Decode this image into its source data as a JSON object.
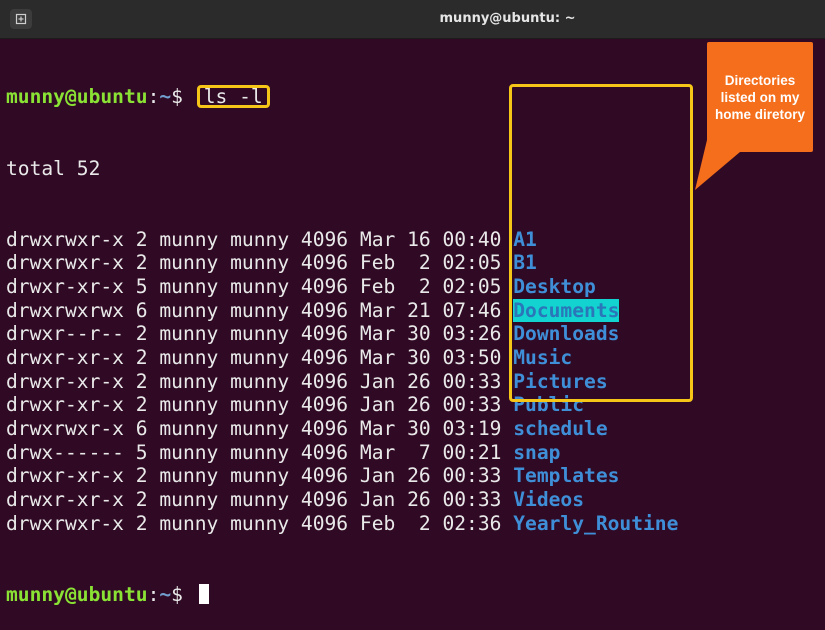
{
  "window": {
    "title": "munny@ubuntu: ~"
  },
  "prompt": {
    "user_host": "munny@ubuntu",
    "sep": ":",
    "path": "~",
    "symbol": "$ "
  },
  "command": "ls -l",
  "total": "total 52",
  "rows": [
    {
      "meta": "drwxrwxr-x 2 munny munny 4096 Mar 16 00:40 ",
      "name": "A1"
    },
    {
      "meta": "drwxrwxr-x 2 munny munny 4096 Feb  2 02:05 ",
      "name": "B1"
    },
    {
      "meta": "drwxr-xr-x 5 munny munny 4096 Feb  2 02:05 ",
      "name": "Desktop"
    },
    {
      "meta": "drwxrwxrwx 6 munny munny 4096 Mar 21 07:46 ",
      "name": "Documents"
    },
    {
      "meta": "drwxr--r-- 2 munny munny 4096 Mar 30 03:26 ",
      "name": "Downloads"
    },
    {
      "meta": "drwxr-xr-x 2 munny munny 4096 Mar 30 03:50 ",
      "name": "Music"
    },
    {
      "meta": "drwxr-xr-x 2 munny munny 4096 Jan 26 00:33 ",
      "name": "Pictures"
    },
    {
      "meta": "drwxr-xr-x 2 munny munny 4096 Jan 26 00:33 ",
      "name": "Public"
    },
    {
      "meta": "drwxrwxr-x 6 munny munny 4096 Mar 30 03:19 ",
      "name": "schedule"
    },
    {
      "meta": "drwx------ 5 munny munny 4096 Mar  7 00:21 ",
      "name": "snap"
    },
    {
      "meta": "drwxr-xr-x 2 munny munny 4096 Jan 26 00:33 ",
      "name": "Templates"
    },
    {
      "meta": "drwxr-xr-x 2 munny munny 4096 Jan 26 00:33 ",
      "name": "Videos"
    },
    {
      "meta": "drwxrwxr-x 2 munny munny 4096 Feb  2 02:36 ",
      "name": "Yearly_Routine"
    }
  ],
  "callout": "Directories listed on my home diretory",
  "colors": {
    "terminal_bg": "#300a24",
    "prompt_user": "#8ae234",
    "prompt_path": "#729fcf",
    "directory": "#3f8fd8",
    "highlight_box": "#f5c518",
    "callout_bg": "#f46e1b"
  },
  "icons": {
    "new_tab": "new-tab-icon"
  }
}
